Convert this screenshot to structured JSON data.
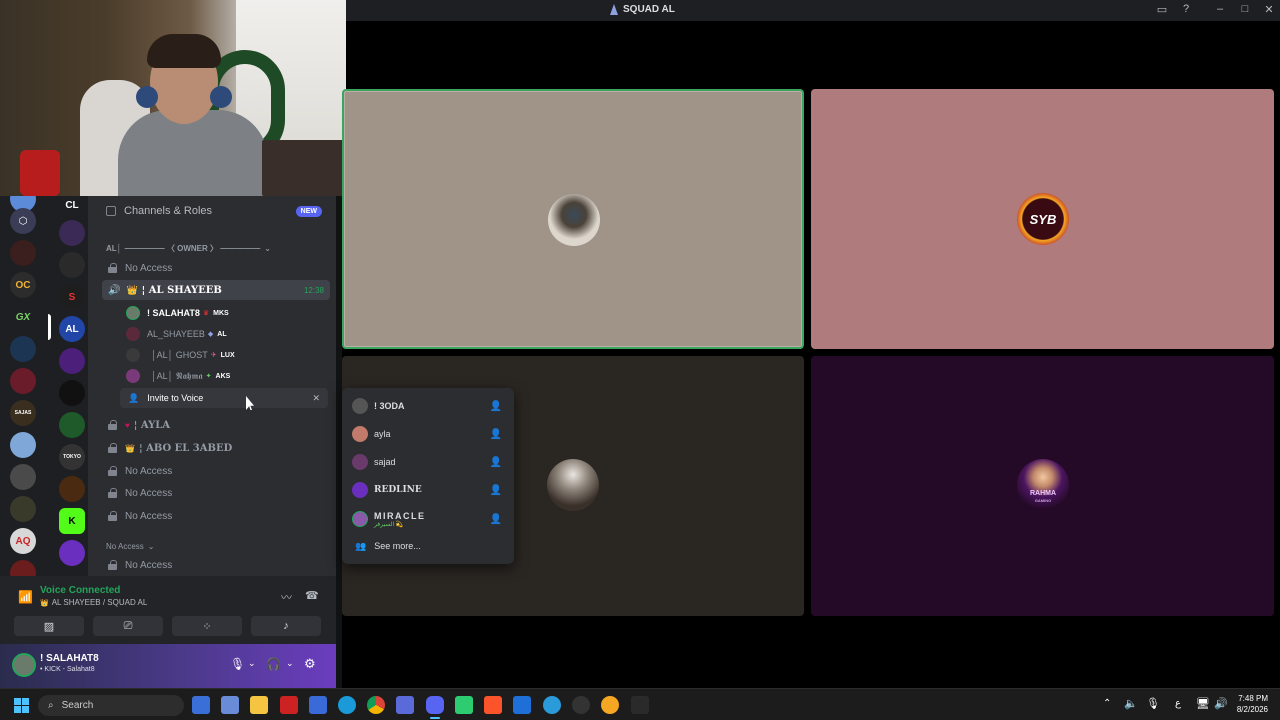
{
  "window": {
    "title": "SQUAD AL"
  },
  "titlebar_icons": [
    "inbox-icon",
    "help-icon",
    "minimize-icon",
    "maximize-icon",
    "close-icon"
  ],
  "channel_panel": {
    "header_label": "Channels & Roles",
    "new_badge": "NEW",
    "category_prefix": "AL│",
    "category_label": "————— 〈 OWNER 〉 —————",
    "channels": [
      {
        "label": "No Access"
      },
      {
        "label": "¦ AL SHAYEEB",
        "time": "12:38"
      }
    ],
    "voice_members": [
      {
        "name": "! SALAHAT8",
        "tag": "MKS"
      },
      {
        "name": "AL_SHAYEEB",
        "tag": "AL"
      },
      {
        "name": "│AL│ GHOST",
        "tag": "LUX"
      },
      {
        "name": "│AL│ 𝕹𝖆𝖍𝖒𝖆",
        "tag": "AKS"
      }
    ],
    "invite_label": "Invite to Voice",
    "channels_after": [
      {
        "label": "¦ AYLA"
      },
      {
        "label": "¦ ABO EL 3ABED"
      },
      {
        "label": "No Access"
      },
      {
        "label": "No Access"
      },
      {
        "label": "No Access"
      }
    ],
    "category2_label": "No Access",
    "last_channel": "No Access"
  },
  "voice_panel": {
    "status": "Voice Connected",
    "location": "AL SHAYEEB / SQUAD AL"
  },
  "user_panel": {
    "name": "! SALAHAT8",
    "activity": "• KICK - Salahat8"
  },
  "popup": {
    "items": [
      {
        "name": "! 3ODA"
      },
      {
        "name": "ayla"
      },
      {
        "name": "sajad"
      },
      {
        "name": "REDLINE"
      },
      {
        "name": "MIRACLE"
      }
    ],
    "miracle_sub": "السيرفر 💫",
    "see_more": "See more..."
  },
  "voice_grid": {
    "tiles": [
      {
        "name": "tile-photo-user",
        "bg": "#9f9487"
      },
      {
        "name": "tile-syb",
        "bg": "#b07b7c",
        "logo": "SYB"
      },
      {
        "name": "tile-cowboy",
        "bg": "#2a2622"
      },
      {
        "name": "tile-rahma",
        "bg": "#250a28",
        "logo": "RAHMA",
        "logo_sub": "GAMING"
      }
    ]
  },
  "server_labels": {
    "cl": "CL",
    "oc": "OC",
    "gx": "GX",
    "al": "AL",
    "k": "K",
    "aq": "AQ",
    "tokyo": "TOKYO",
    "sajas": "SAJAS"
  },
  "taskbar": {
    "search_placeholder": "Search",
    "time": "7:48 PM",
    "date": "8/2/2026",
    "lang": "ع"
  },
  "colors": {
    "discord_bg": "#2b2d31",
    "rail_bg": "#1e1f22",
    "accent": "#5865f2",
    "green": "#23a55a"
  }
}
